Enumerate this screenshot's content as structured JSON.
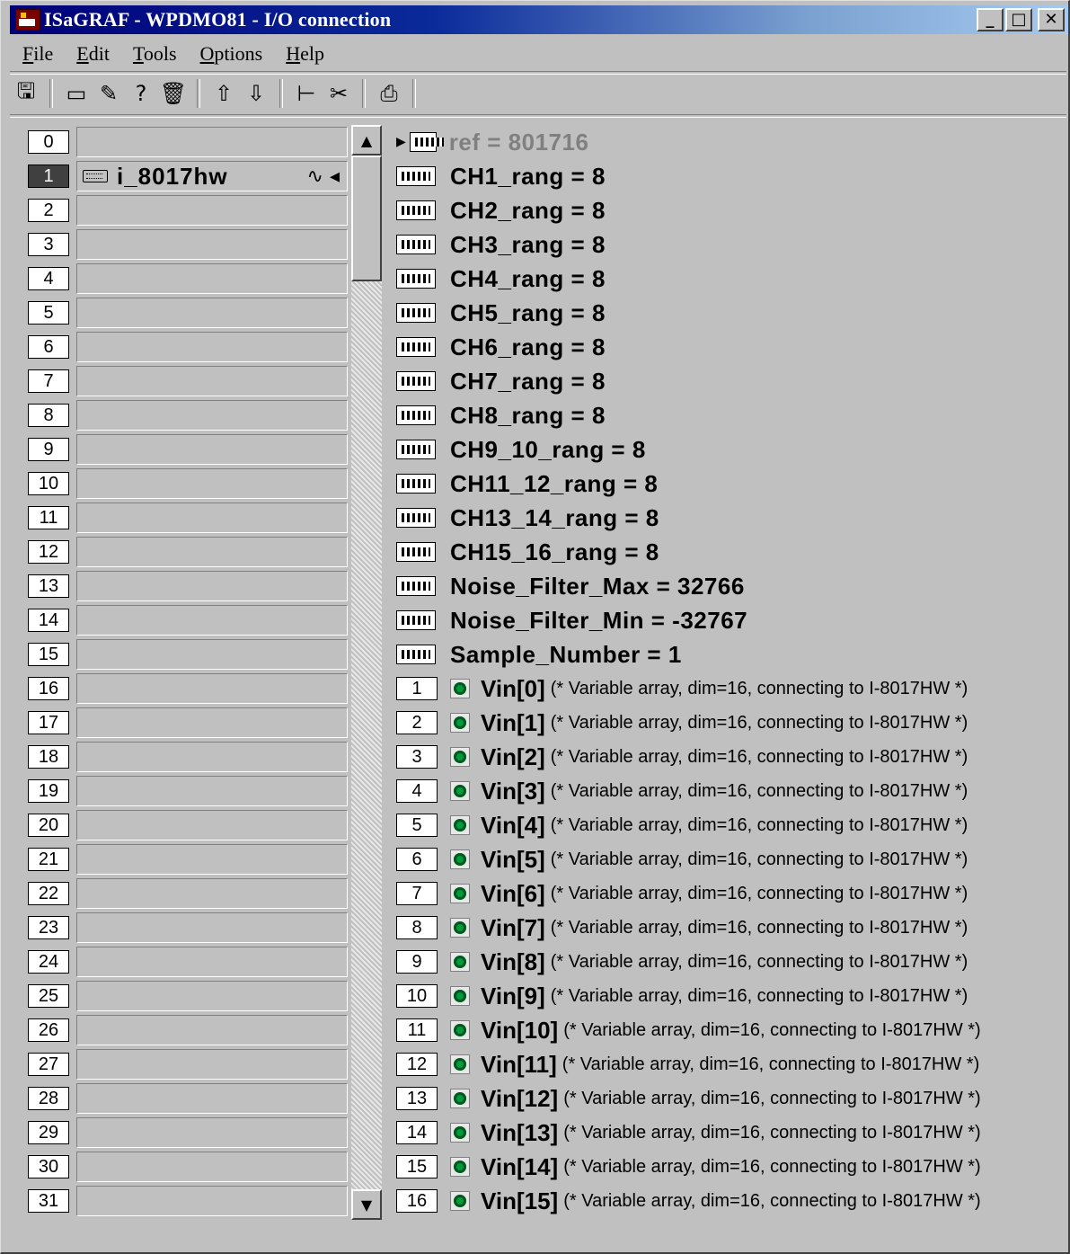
{
  "window": {
    "title": "ISaGRAF - WPDMO81 - I/O connection",
    "controls": {
      "minimize": "_",
      "maximize": "□",
      "close": "✕"
    }
  },
  "menu": [
    {
      "mnemonic": "F",
      "rest": "ile"
    },
    {
      "mnemonic": "E",
      "rest": "dit"
    },
    {
      "mnemonic": "T",
      "rest": "ools"
    },
    {
      "mnemonic": "O",
      "rest": "ptions"
    },
    {
      "mnemonic": "H",
      "rest": "elp"
    }
  ],
  "toolbar": {
    "icons": [
      "save-icon",
      "board-icon",
      "edit-board-icon",
      "help-board-icon",
      "delete-icon",
      "move-up-icon",
      "move-down-icon",
      "tree-icon",
      "cut-icon",
      "print-icon"
    ]
  },
  "slots": {
    "numbers": [
      "0",
      "1",
      "2",
      "3",
      "4",
      "5",
      "6",
      "7",
      "8",
      "9",
      "10",
      "11",
      "12",
      "13",
      "14",
      "15",
      "16",
      "17",
      "18",
      "19",
      "20",
      "21",
      "22",
      "23",
      "24",
      "25",
      "26",
      "27",
      "28",
      "29",
      "30",
      "31"
    ],
    "active_index": 1,
    "board_name": "i_8017hw",
    "board_marks": "∿ ◂"
  },
  "params": [
    "ref = 801716",
    "CH1_rang = 8",
    "CH2_rang = 8",
    "CH3_rang = 8",
    "CH4_rang = 8",
    "CH5_rang = 8",
    "CH6_rang = 8",
    "CH7_rang = 8",
    "CH8_rang = 8",
    "CH9_10_rang = 8",
    "CH11_12_rang = 8",
    "CH13_14_rang = 8",
    "CH15_16_rang = 8",
    "Noise_Filter_Max = 32766",
    "Noise_Filter_Min = -32767",
    "Sample_Number = 1"
  ],
  "channels": [
    {
      "num": "1",
      "name": "Vin[0]",
      "comment": "(* Variable array, dim=16, connecting to I-8017HW *)"
    },
    {
      "num": "2",
      "name": "Vin[1]",
      "comment": "(* Variable array, dim=16, connecting to I-8017HW *)"
    },
    {
      "num": "3",
      "name": "Vin[2]",
      "comment": "(* Variable array, dim=16, connecting to I-8017HW *)"
    },
    {
      "num": "4",
      "name": "Vin[3]",
      "comment": "(* Variable array, dim=16, connecting to I-8017HW *)"
    },
    {
      "num": "5",
      "name": "Vin[4]",
      "comment": "(* Variable array, dim=16, connecting to I-8017HW *)"
    },
    {
      "num": "6",
      "name": "Vin[5]",
      "comment": "(* Variable array, dim=16, connecting to I-8017HW *)"
    },
    {
      "num": "7",
      "name": "Vin[6]",
      "comment": "(* Variable array, dim=16, connecting to I-8017HW *)"
    },
    {
      "num": "8",
      "name": "Vin[7]",
      "comment": "(* Variable array, dim=16, connecting to I-8017HW *)"
    },
    {
      "num": "9",
      "name": "Vin[8]",
      "comment": "(* Variable array, dim=16, connecting to I-8017HW *)"
    },
    {
      "num": "10",
      "name": "Vin[9]",
      "comment": "(* Variable array, dim=16, connecting to I-8017HW *)"
    },
    {
      "num": "11",
      "name": "Vin[10]",
      "comment": "(* Variable array, dim=16, connecting to I-8017HW *)"
    },
    {
      "num": "12",
      "name": "Vin[11]",
      "comment": "(* Variable array, dim=16, connecting to I-8017HW *)"
    },
    {
      "num": "13",
      "name": "Vin[12]",
      "comment": "(* Variable array, dim=16, connecting to I-8017HW *)"
    },
    {
      "num": "14",
      "name": "Vin[13]",
      "comment": "(* Variable array, dim=16, connecting to I-8017HW *)"
    },
    {
      "num": "15",
      "name": "Vin[14]",
      "comment": "(* Variable array, dim=16, connecting to I-8017HW *)"
    },
    {
      "num": "16",
      "name": "Vin[15]",
      "comment": "(* Variable array, dim=16, connecting to I-8017HW *)"
    }
  ],
  "scrollbar": {
    "up": "▲",
    "down": "▼"
  }
}
